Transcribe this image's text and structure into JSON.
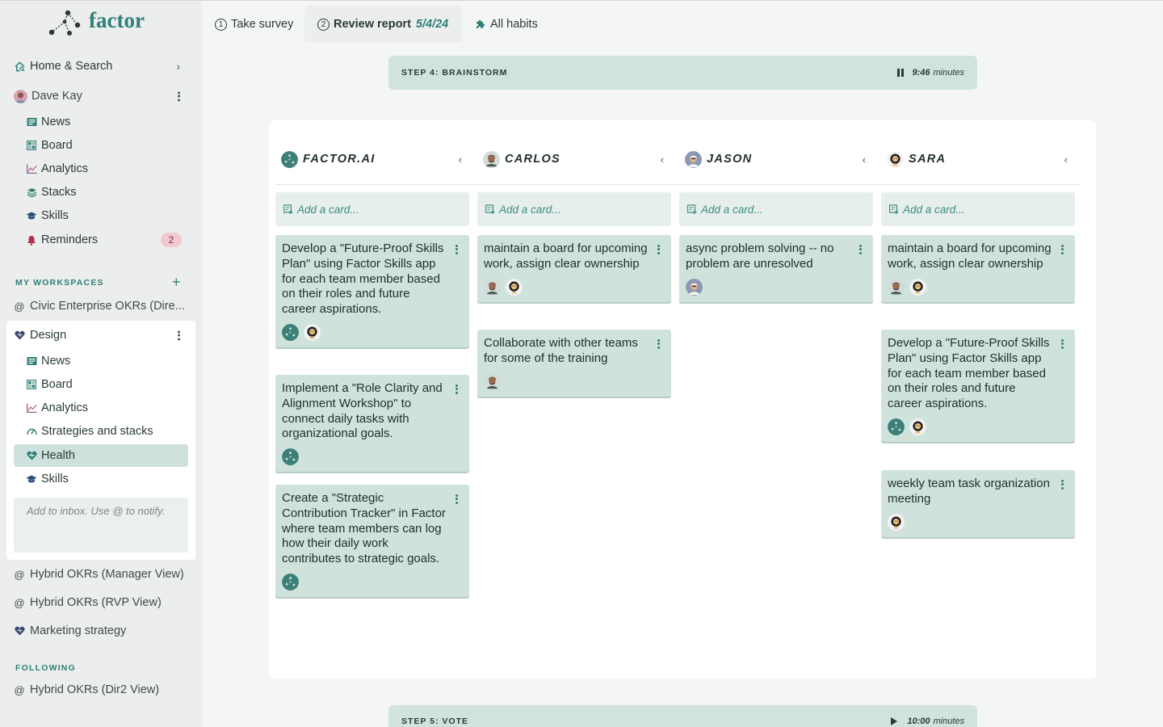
{
  "brand": {
    "name": "factor"
  },
  "tabs": [
    {
      "num": "1",
      "label": "Take survey"
    },
    {
      "num": "2",
      "label": "Review report",
      "date": "5/4/24"
    },
    {
      "label": "All habits"
    }
  ],
  "sidebar": {
    "home": "Home & Search",
    "user": "Dave Kay",
    "user_items": [
      {
        "label": "News",
        "icon": "news-icon"
      },
      {
        "label": "Board",
        "icon": "board-icon"
      },
      {
        "label": "Analytics",
        "icon": "analytics-icon"
      },
      {
        "label": "Stacks",
        "icon": "stacks-icon"
      },
      {
        "label": "Skills",
        "icon": "skills-icon"
      },
      {
        "label": "Reminders",
        "icon": "bell-icon",
        "badge": "2"
      }
    ],
    "my_workspaces_title": "MY WORKSPACES",
    "workspaces": [
      "Civic Enterprise OKRs (Dire...",
      "Design",
      "Hybrid OKRs (Manager View)",
      "Hybrid OKRs (RVP View)",
      "Marketing strategy"
    ],
    "design_items": [
      {
        "label": "News",
        "icon": "news-icon"
      },
      {
        "label": "Board",
        "icon": "board-icon"
      },
      {
        "label": "Analytics",
        "icon": "analytics-icon"
      },
      {
        "label": "Strategies and stacks",
        "icon": "gauge-icon"
      },
      {
        "label": "Health",
        "icon": "health-icon",
        "active": true
      },
      {
        "label": "Skills",
        "icon": "skills-icon"
      }
    ],
    "inbox_placeholder": "Add to inbox. Use @ to notify.",
    "following_title": "FOLLOWING",
    "following": [
      "Hybrid OKRs (Dir2 View)"
    ]
  },
  "steps": {
    "current": {
      "title": "STEP 4: BRAINSTORM",
      "time": "9:46",
      "unit": "minutes"
    },
    "next": {
      "title": "STEP 5: VOTE",
      "time": "10:00",
      "unit": "minutes"
    }
  },
  "board": {
    "add_card_placeholder": "Add a card...",
    "columns": [
      {
        "name": "FACTOR.AI",
        "cards": [
          "Develop a \"Future-Proof Skills Plan\" using Factor Skills app for each team member based on their roles and future career aspirations.",
          "Implement a \"Role Clarity and Alignment Workshop\" to connect daily tasks with organizational goals.",
          "Create a \"Strategic Contribution Tracker\" in Factor where team members can log how their daily work contributes to strategic goals."
        ]
      },
      {
        "name": "CARLOS",
        "cards": [
          "maintain a board for upcoming work, assign clear ownership",
          "Collaborate with other teams for some of the training"
        ]
      },
      {
        "name": "JASON",
        "cards": [
          "async problem solving -- no problem are unresolved"
        ]
      },
      {
        "name": "SARA",
        "cards": [
          "maintain a board for upcoming work, assign clear ownership",
          "Develop a \"Future-Proof Skills Plan\" using Factor Skills app for each team member based on their roles and future career aspirations.",
          "weekly team task organization meeting"
        ]
      }
    ]
  },
  "colors": {
    "accent": "#2f7f78",
    "card": "#cfe3dc",
    "step": "#d1e3de"
  }
}
